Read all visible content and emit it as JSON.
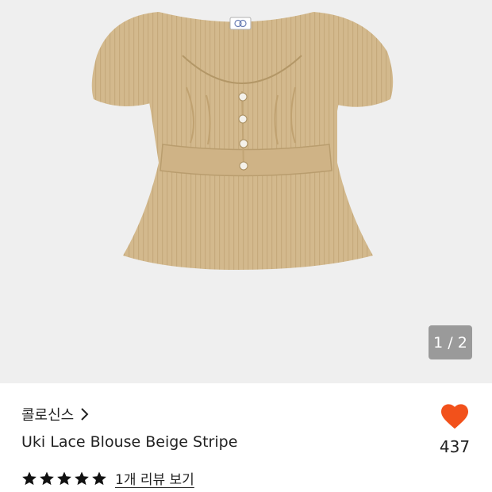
{
  "gallery": {
    "counter": "1 / 2",
    "image_alt": "beige striped puff-sleeve blouse"
  },
  "product": {
    "brand": "콜로신스",
    "brand_chevron_icon": "chevron-right-icon",
    "name": "Uki Lace Blouse Beige Stripe",
    "rating": 5,
    "stars_icon": "star-icon",
    "review_link": "1개 리뷰 보기"
  },
  "like": {
    "icon": "heart-icon",
    "count": "437",
    "color": "#f2511b"
  },
  "colors": {
    "gallery_bg": "#efefef",
    "blouse": "#d3b98d",
    "counter_bg": "#9a9a9a"
  }
}
